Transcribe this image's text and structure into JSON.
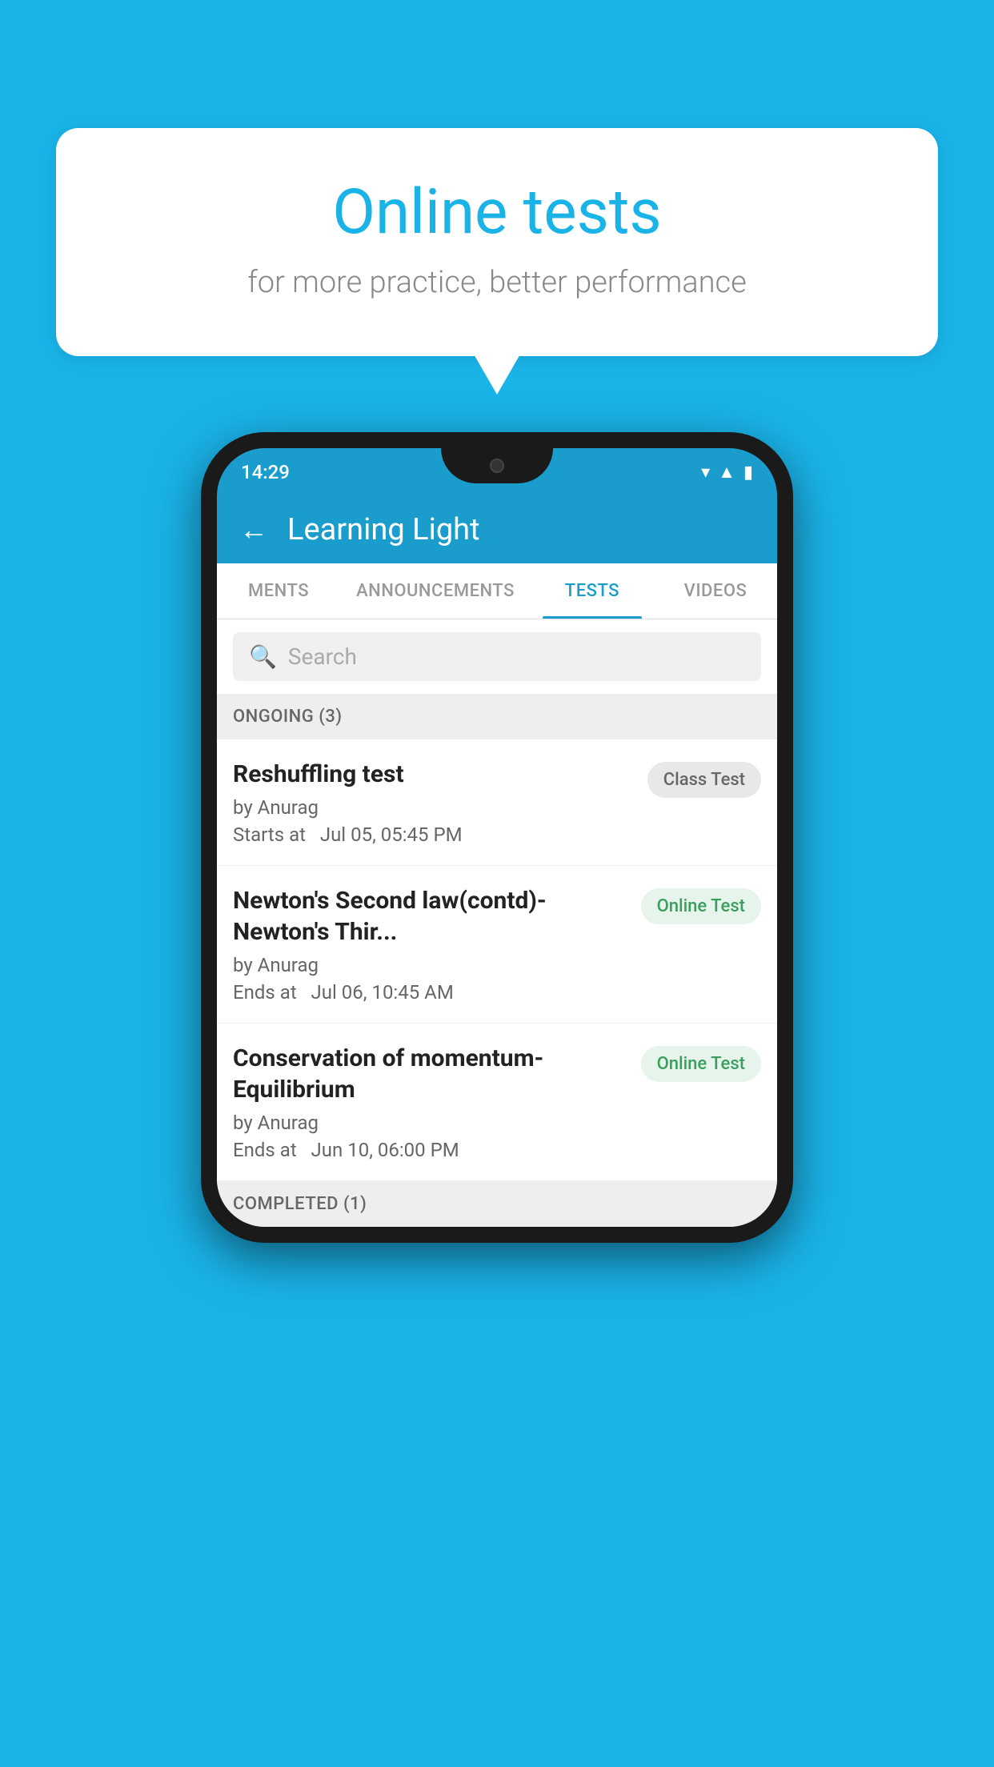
{
  "background": {
    "color": "#1ab3e8"
  },
  "bubble": {
    "title": "Online tests",
    "subtitle": "for more practice, better performance"
  },
  "phone": {
    "status_bar": {
      "time": "14:29"
    },
    "header": {
      "title": "Learning Light",
      "back_label": "←"
    },
    "tabs": [
      {
        "label": "MENTS",
        "active": false
      },
      {
        "label": "ANNOUNCEMENTS",
        "active": false
      },
      {
        "label": "TESTS",
        "active": true
      },
      {
        "label": "VIDEOS",
        "active": false
      }
    ],
    "search": {
      "placeholder": "Search"
    },
    "sections": [
      {
        "title": "ONGOING (3)",
        "items": [
          {
            "name": "Reshuffling test",
            "author": "by Anurag",
            "time": "Starts at  Jul 05, 05:45 PM",
            "badge": "Class Test",
            "badge_type": "class"
          },
          {
            "name": "Newton's Second law(contd)-Newton's Thir...",
            "author": "by Anurag",
            "time": "Ends at  Jul 06, 10:45 AM",
            "badge": "Online Test",
            "badge_type": "online"
          },
          {
            "name": "Conservation of momentum-Equilibrium",
            "author": "by Anurag",
            "time": "Ends at  Jun 10, 06:00 PM",
            "badge": "Online Test",
            "badge_type": "online"
          }
        ]
      },
      {
        "title": "COMPLETED (1)",
        "items": []
      }
    ]
  }
}
